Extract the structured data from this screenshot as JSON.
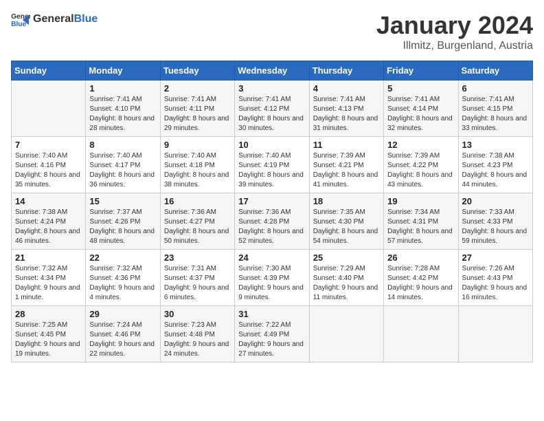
{
  "logo": {
    "general": "General",
    "blue": "Blue"
  },
  "header": {
    "month": "January 2024",
    "location": "Illmitz, Burgenland, Austria"
  },
  "weekdays": [
    "Sunday",
    "Monday",
    "Tuesday",
    "Wednesday",
    "Thursday",
    "Friday",
    "Saturday"
  ],
  "weeks": [
    [
      {
        "day": "",
        "sunrise": "",
        "sunset": "",
        "daylight": ""
      },
      {
        "day": "1",
        "sunrise": "Sunrise: 7:41 AM",
        "sunset": "Sunset: 4:10 PM",
        "daylight": "Daylight: 8 hours and 28 minutes."
      },
      {
        "day": "2",
        "sunrise": "Sunrise: 7:41 AM",
        "sunset": "Sunset: 4:11 PM",
        "daylight": "Daylight: 8 hours and 29 minutes."
      },
      {
        "day": "3",
        "sunrise": "Sunrise: 7:41 AM",
        "sunset": "Sunset: 4:12 PM",
        "daylight": "Daylight: 8 hours and 30 minutes."
      },
      {
        "day": "4",
        "sunrise": "Sunrise: 7:41 AM",
        "sunset": "Sunset: 4:13 PM",
        "daylight": "Daylight: 8 hours and 31 minutes."
      },
      {
        "day": "5",
        "sunrise": "Sunrise: 7:41 AM",
        "sunset": "Sunset: 4:14 PM",
        "daylight": "Daylight: 8 hours and 32 minutes."
      },
      {
        "day": "6",
        "sunrise": "Sunrise: 7:41 AM",
        "sunset": "Sunset: 4:15 PM",
        "daylight": "Daylight: 8 hours and 33 minutes."
      }
    ],
    [
      {
        "day": "7",
        "sunrise": "Sunrise: 7:40 AM",
        "sunset": "Sunset: 4:16 PM",
        "daylight": "Daylight: 8 hours and 35 minutes."
      },
      {
        "day": "8",
        "sunrise": "Sunrise: 7:40 AM",
        "sunset": "Sunset: 4:17 PM",
        "daylight": "Daylight: 8 hours and 36 minutes."
      },
      {
        "day": "9",
        "sunrise": "Sunrise: 7:40 AM",
        "sunset": "Sunset: 4:18 PM",
        "daylight": "Daylight: 8 hours and 38 minutes."
      },
      {
        "day": "10",
        "sunrise": "Sunrise: 7:40 AM",
        "sunset": "Sunset: 4:19 PM",
        "daylight": "Daylight: 8 hours and 39 minutes."
      },
      {
        "day": "11",
        "sunrise": "Sunrise: 7:39 AM",
        "sunset": "Sunset: 4:21 PM",
        "daylight": "Daylight: 8 hours and 41 minutes."
      },
      {
        "day": "12",
        "sunrise": "Sunrise: 7:39 AM",
        "sunset": "Sunset: 4:22 PM",
        "daylight": "Daylight: 8 hours and 43 minutes."
      },
      {
        "day": "13",
        "sunrise": "Sunrise: 7:38 AM",
        "sunset": "Sunset: 4:23 PM",
        "daylight": "Daylight: 8 hours and 44 minutes."
      }
    ],
    [
      {
        "day": "14",
        "sunrise": "Sunrise: 7:38 AM",
        "sunset": "Sunset: 4:24 PM",
        "daylight": "Daylight: 8 hours and 46 minutes."
      },
      {
        "day": "15",
        "sunrise": "Sunrise: 7:37 AM",
        "sunset": "Sunset: 4:26 PM",
        "daylight": "Daylight: 8 hours and 48 minutes."
      },
      {
        "day": "16",
        "sunrise": "Sunrise: 7:36 AM",
        "sunset": "Sunset: 4:27 PM",
        "daylight": "Daylight: 8 hours and 50 minutes."
      },
      {
        "day": "17",
        "sunrise": "Sunrise: 7:36 AM",
        "sunset": "Sunset: 4:28 PM",
        "daylight": "Daylight: 8 hours and 52 minutes."
      },
      {
        "day": "18",
        "sunrise": "Sunrise: 7:35 AM",
        "sunset": "Sunset: 4:30 PM",
        "daylight": "Daylight: 8 hours and 54 minutes."
      },
      {
        "day": "19",
        "sunrise": "Sunrise: 7:34 AM",
        "sunset": "Sunset: 4:31 PM",
        "daylight": "Daylight: 8 hours and 57 minutes."
      },
      {
        "day": "20",
        "sunrise": "Sunrise: 7:33 AM",
        "sunset": "Sunset: 4:33 PM",
        "daylight": "Daylight: 8 hours and 59 minutes."
      }
    ],
    [
      {
        "day": "21",
        "sunrise": "Sunrise: 7:32 AM",
        "sunset": "Sunset: 4:34 PM",
        "daylight": "Daylight: 9 hours and 1 minute."
      },
      {
        "day": "22",
        "sunrise": "Sunrise: 7:32 AM",
        "sunset": "Sunset: 4:36 PM",
        "daylight": "Daylight: 9 hours and 4 minutes."
      },
      {
        "day": "23",
        "sunrise": "Sunrise: 7:31 AM",
        "sunset": "Sunset: 4:37 PM",
        "daylight": "Daylight: 9 hours and 6 minutes."
      },
      {
        "day": "24",
        "sunrise": "Sunrise: 7:30 AM",
        "sunset": "Sunset: 4:39 PM",
        "daylight": "Daylight: 9 hours and 9 minutes."
      },
      {
        "day": "25",
        "sunrise": "Sunrise: 7:29 AM",
        "sunset": "Sunset: 4:40 PM",
        "daylight": "Daylight: 9 hours and 11 minutes."
      },
      {
        "day": "26",
        "sunrise": "Sunrise: 7:28 AM",
        "sunset": "Sunset: 4:42 PM",
        "daylight": "Daylight: 9 hours and 14 minutes."
      },
      {
        "day": "27",
        "sunrise": "Sunrise: 7:26 AM",
        "sunset": "Sunset: 4:43 PM",
        "daylight": "Daylight: 9 hours and 16 minutes."
      }
    ],
    [
      {
        "day": "28",
        "sunrise": "Sunrise: 7:25 AM",
        "sunset": "Sunset: 4:45 PM",
        "daylight": "Daylight: 9 hours and 19 minutes."
      },
      {
        "day": "29",
        "sunrise": "Sunrise: 7:24 AM",
        "sunset": "Sunset: 4:46 PM",
        "daylight": "Daylight: 9 hours and 22 minutes."
      },
      {
        "day": "30",
        "sunrise": "Sunrise: 7:23 AM",
        "sunset": "Sunset: 4:48 PM",
        "daylight": "Daylight: 9 hours and 24 minutes."
      },
      {
        "day": "31",
        "sunrise": "Sunrise: 7:22 AM",
        "sunset": "Sunset: 4:49 PM",
        "daylight": "Daylight: 9 hours and 27 minutes."
      },
      {
        "day": "",
        "sunrise": "",
        "sunset": "",
        "daylight": ""
      },
      {
        "day": "",
        "sunrise": "",
        "sunset": "",
        "daylight": ""
      },
      {
        "day": "",
        "sunrise": "",
        "sunset": "",
        "daylight": ""
      }
    ]
  ]
}
